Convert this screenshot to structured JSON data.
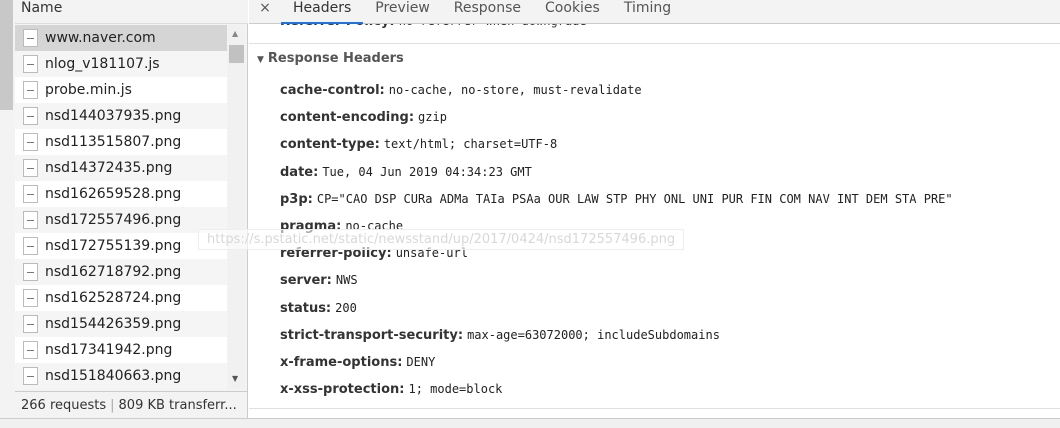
{
  "list": {
    "header": "Name",
    "items": [
      {
        "name": "www.naver.com",
        "type": "doc"
      },
      {
        "name": "nlog_v181107.js",
        "type": "doc"
      },
      {
        "name": "probe.min.js",
        "type": "doc"
      },
      {
        "name": "nsd144037935.png",
        "type": "img"
      },
      {
        "name": "nsd113515807.png",
        "type": "img"
      },
      {
        "name": "nsd14372435.png",
        "type": "img"
      },
      {
        "name": "nsd162659528.png",
        "type": "img"
      },
      {
        "name": "nsd172557496.png",
        "type": "img"
      },
      {
        "name": "nsd172755139.png",
        "type": "img"
      },
      {
        "name": "nsd162718792.png",
        "type": "img"
      },
      {
        "name": "nsd162528724.png",
        "type": "img"
      },
      {
        "name": "nsd154426359.png",
        "type": "img"
      },
      {
        "name": "nsd17341942.png",
        "type": "img"
      },
      {
        "name": "nsd151840663.png",
        "type": "img"
      }
    ]
  },
  "footer": {
    "requests": "266 requests",
    "transferred": "809 KB transferr..."
  },
  "tabs": {
    "close": "×",
    "items": [
      "Headers",
      "Preview",
      "Response",
      "Cookies",
      "Timing"
    ],
    "active": "Headers"
  },
  "clipped_row": {
    "key": "Referrer Policy:",
    "value": "no-referrer-when-downgrade"
  },
  "section": {
    "title": "Response Headers"
  },
  "headers": [
    {
      "key": "cache-control:",
      "value": "no-cache, no-store, must-revalidate"
    },
    {
      "key": "content-encoding:",
      "value": "gzip"
    },
    {
      "key": "content-type:",
      "value": "text/html; charset=UTF-8"
    },
    {
      "key": "date:",
      "value": "Tue, 04 Jun 2019 04:34:23 GMT"
    },
    {
      "key": "p3p:",
      "value": "CP=\"CAO DSP CURa ADMa TAIa PSAa OUR LAW STP PHY ONL UNI PUR FIN COM NAV INT DEM STA PRE\""
    },
    {
      "key": "pragma:",
      "value": "no-cache"
    },
    {
      "key": "referrer-policy:",
      "value": "unsafe-url"
    },
    {
      "key": "server:",
      "value": "NWS"
    },
    {
      "key": "status:",
      "value": "200"
    },
    {
      "key": "strict-transport-security:",
      "value": "max-age=63072000; includeSubdomains"
    },
    {
      "key": "x-frame-options:",
      "value": "DENY"
    },
    {
      "key": "x-xss-protection:",
      "value": "1; mode=block"
    }
  ],
  "tooltip": "https://s.pstatic.net/static/newsstand/up/2017/0424/nsd172557496.png"
}
